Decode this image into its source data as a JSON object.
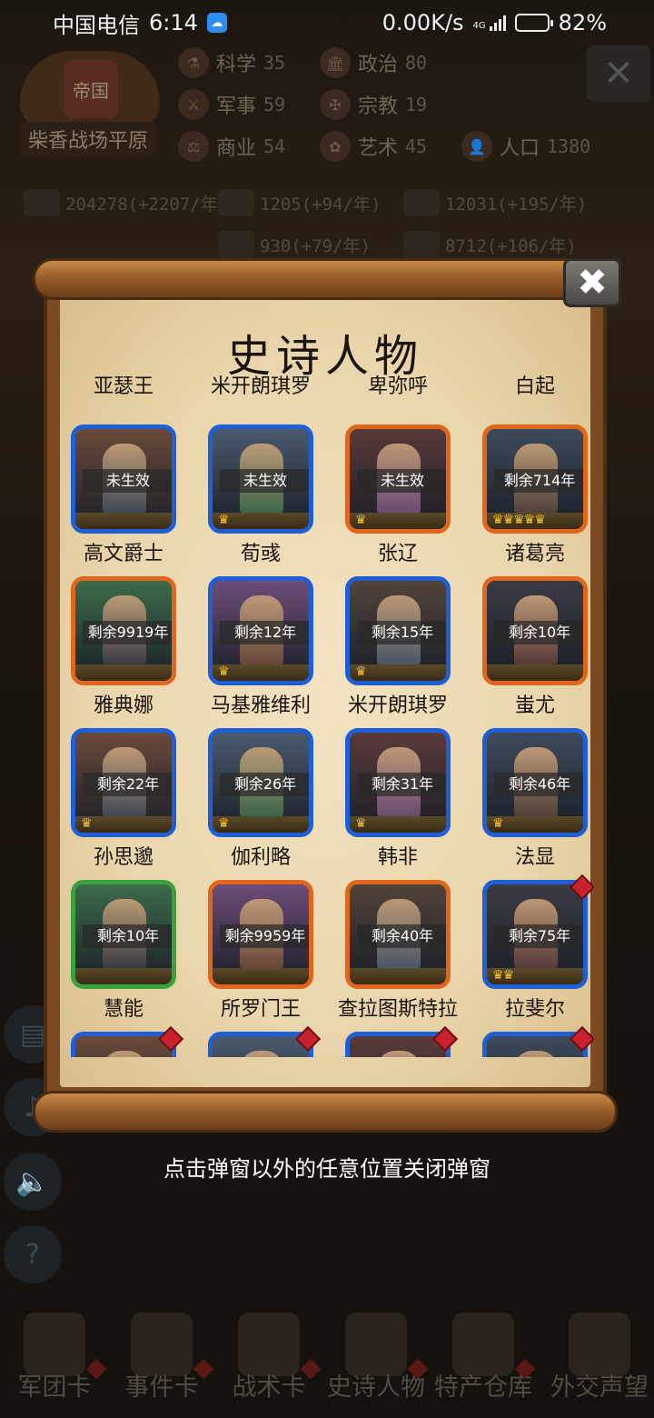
{
  "status_bar": {
    "carrier": "中国电信",
    "time": "6:14",
    "speed": "0.00K/s",
    "network": "4G",
    "battery": "82%",
    "battery_level": 0.82
  },
  "empire": {
    "badge_label": "帝国",
    "name": "柴香战场平原"
  },
  "stats": [
    {
      "icon": "science-icon",
      "label": "科学",
      "value": "35"
    },
    {
      "icon": "politics-icon",
      "label": "政治",
      "value": "80"
    },
    {
      "icon": "military-icon",
      "label": "军事",
      "value": "59"
    },
    {
      "icon": "religion-icon",
      "label": "宗教",
      "value": "19"
    },
    {
      "icon": "commerce-icon",
      "label": "商业",
      "value": "54"
    },
    {
      "icon": "art-icon",
      "label": "艺术",
      "value": "45"
    },
    {
      "icon": "population-icon",
      "label": "人口",
      "value": "1380"
    }
  ],
  "resources": [
    {
      "icon": "gold-icon",
      "text": "204278(+2207/年)"
    },
    {
      "icon": "wood-icon",
      "text": "1205(+94/年)"
    },
    {
      "icon": "stone-icon",
      "text": "12031(+195/年)"
    },
    {
      "icon": "iron-icon",
      "text": "930(+79/年)"
    },
    {
      "icon": "food-icon",
      "text": "8712(+106/年)"
    }
  ],
  "popup": {
    "title": "史诗人物",
    "close_label": "✖",
    "hint": "点击弹窗以外的任意位置关闭弹窗"
  },
  "characters": {
    "row0": [
      {
        "name": "亚瑟王",
        "color": "orange"
      },
      {
        "name": "米开朗琪罗",
        "color": "blue"
      },
      {
        "name": "卑弥呼",
        "color": "orange"
      },
      {
        "name": "白起",
        "color": "orange"
      }
    ],
    "row1": [
      {
        "name": "高文爵士",
        "status": "未生效",
        "color": "blue",
        "crowns": 0
      },
      {
        "name": "荀彧",
        "status": "未生效",
        "color": "blue",
        "crowns": 1
      },
      {
        "name": "张辽",
        "status": "未生效",
        "color": "orange",
        "crowns": 1
      },
      {
        "name": "诸葛亮",
        "status": "剩余714年",
        "color": "orange",
        "crowns": 5
      }
    ],
    "row2": [
      {
        "name": "雅典娜",
        "status": "剩余9919年",
        "color": "orange",
        "crowns": 0
      },
      {
        "name": "马基雅维利",
        "status": "剩余12年",
        "color": "blue",
        "crowns": 1
      },
      {
        "name": "米开朗琪罗",
        "status": "剩余15年",
        "color": "blue",
        "crowns": 1
      },
      {
        "name": "蚩尤",
        "status": "剩余10年",
        "color": "orange",
        "crowns": 0
      }
    ],
    "row3": [
      {
        "name": "孙思邈",
        "status": "剩余22年",
        "color": "blue",
        "crowns": 1
      },
      {
        "name": "伽利略",
        "status": "剩余26年",
        "color": "blue",
        "crowns": 1
      },
      {
        "name": "韩非",
        "status": "剩余31年",
        "color": "blue",
        "crowns": 1
      },
      {
        "name": "法显",
        "status": "剩余46年",
        "color": "blue",
        "crowns": 1
      }
    ],
    "row4": [
      {
        "name": "慧能",
        "status": "剩余10年",
        "color": "green",
        "crowns": 0
      },
      {
        "name": "所罗门王",
        "status": "剩余9959年",
        "color": "orange",
        "crowns": 0
      },
      {
        "name": "查拉图斯特拉",
        "status": "剩余40年",
        "color": "orange",
        "crowns": 0
      },
      {
        "name": "拉斐尔",
        "status": "剩余75年",
        "color": "blue",
        "crowns": 2,
        "new": true
      }
    ],
    "row5": [
      {
        "color": "blue",
        "new": true
      },
      {
        "color": "blue",
        "new": true
      },
      {
        "color": "blue",
        "new": true
      },
      {
        "color": "blue",
        "new": true
      }
    ]
  },
  "bottom_nav": [
    {
      "label": "军团卡",
      "icon": "helmet-icon"
    },
    {
      "label": "事件卡",
      "icon": "scroll-icon"
    },
    {
      "label": "战术卡",
      "icon": "shield-icon"
    },
    {
      "label": "史诗人物",
      "icon": "crown-icon"
    },
    {
      "label": "特产仓库",
      "icon": "chest-icon"
    },
    {
      "label": "外交声望",
      "icon": "letter-icon"
    }
  ],
  "side_buttons": [
    {
      "icon": "chat-icon"
    },
    {
      "icon": "music-icon"
    },
    {
      "icon": "volume-icon"
    },
    {
      "icon": "help-icon",
      "label": "?"
    }
  ],
  "colors": {
    "frame_blue": "#1e5fd6",
    "frame_orange": "#e0661c",
    "frame_green": "#3aa23a",
    "crown": "#f1c231",
    "new_badge": "#c8202c"
  }
}
